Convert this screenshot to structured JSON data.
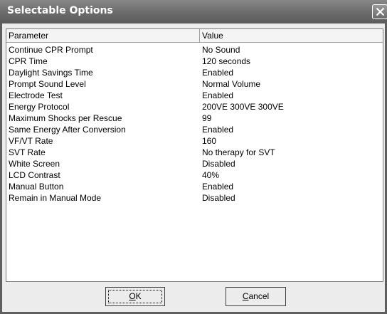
{
  "window": {
    "title": "Selectable Options"
  },
  "list": {
    "headers": {
      "parameter": "Parameter",
      "value": "Value"
    },
    "rows": [
      {
        "parameter": "Continue CPR Prompt",
        "value": "No Sound"
      },
      {
        "parameter": "CPR Time",
        "value": "120 seconds"
      },
      {
        "parameter": "Daylight Savings Time",
        "value": "Enabled"
      },
      {
        "parameter": "Prompt Sound Level",
        "value": "Normal Volume"
      },
      {
        "parameter": "Electrode Test",
        "value": "Enabled"
      },
      {
        "parameter": "Energy Protocol",
        "value": "200VE  300VE  300VE"
      },
      {
        "parameter": "Maximum Shocks per Rescue",
        "value": "99"
      },
      {
        "parameter": "Same Energy After Conversion",
        "value": "Enabled"
      },
      {
        "parameter": "VF/VT Rate",
        "value": "160"
      },
      {
        "parameter": "SVT Rate",
        "value": "No therapy for SVT"
      },
      {
        "parameter": "White Screen",
        "value": "Disabled"
      },
      {
        "parameter": "LCD Contrast",
        "value": "40%"
      },
      {
        "parameter": "Manual Button",
        "value": "Enabled"
      },
      {
        "parameter": "Remain in Manual Mode",
        "value": "Disabled"
      }
    ]
  },
  "buttons": {
    "ok": {
      "mnemonic": "O",
      "rest": "K"
    },
    "cancel": {
      "mnemonic": "C",
      "rest": "ancel"
    }
  },
  "icons": {
    "close": "close-icon"
  }
}
